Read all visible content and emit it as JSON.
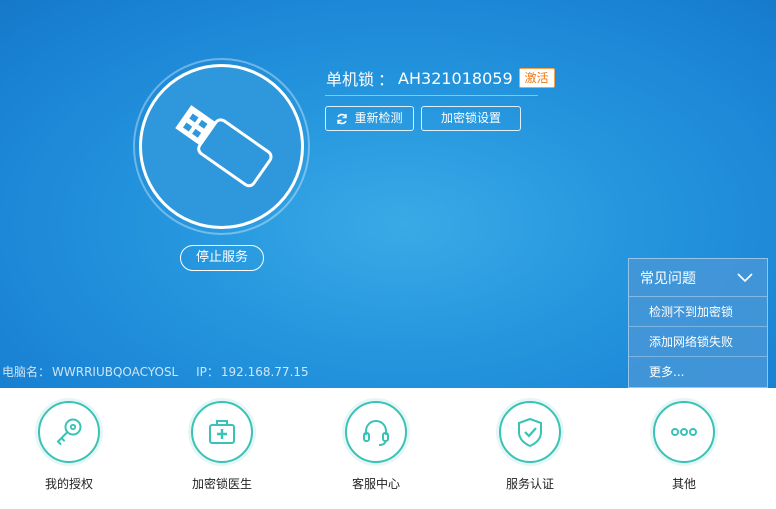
{
  "device": {
    "title_label": "单机锁",
    "title_separator": "：",
    "device_id": "AH321018059",
    "activate_badge": "激活",
    "stop_service_label": "停止服务",
    "recheck_label": "重新检测",
    "lock_settings_label": "加密锁设置"
  },
  "pc_info": {
    "name_label": "电脑名：",
    "name_value": "WWRRIUBQOACYOSL",
    "ip_label": "IP：",
    "ip_value": "192.168.77.15"
  },
  "faq": {
    "title": "常见问题",
    "items": [
      "检测不到加密锁",
      "添加网络锁失败",
      "更多..."
    ]
  },
  "toolbar": {
    "items": [
      {
        "label": "我的授权",
        "icon": "key-icon"
      },
      {
        "label": "加密锁医生",
        "icon": "medical-kit-icon"
      },
      {
        "label": "客服中心",
        "icon": "headset-icon"
      },
      {
        "label": "服务认证",
        "icon": "shield-check-icon"
      },
      {
        "label": "其他",
        "icon": "more-dots-icon"
      }
    ]
  },
  "colors": {
    "accent_teal": "#39c3b7",
    "top_blue": "#2596de",
    "badge_orange": "#ec7a18"
  }
}
